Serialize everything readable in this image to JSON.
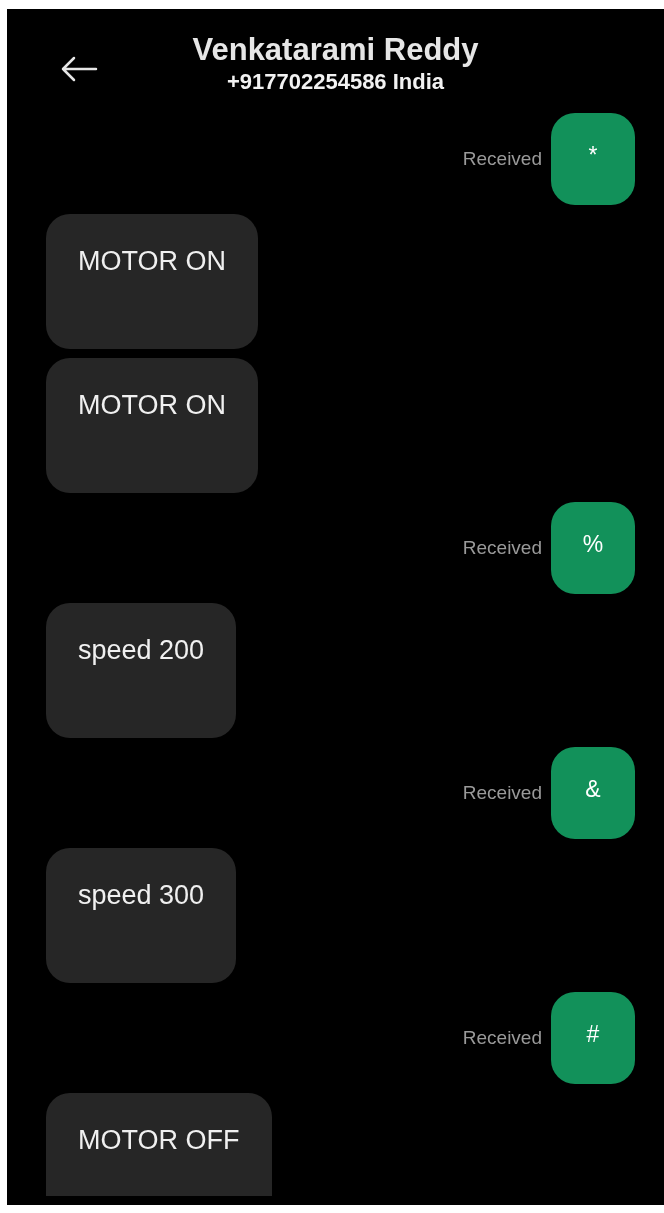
{
  "header": {
    "title": "Venkatarami Reddy",
    "subtitle": "+917702254586 India"
  },
  "messages": [
    {
      "kind": "sent",
      "text": "*",
      "status": "Received"
    },
    {
      "kind": "received",
      "text": "MOTOR ON"
    },
    {
      "kind": "received",
      "text": "MOTOR ON"
    },
    {
      "kind": "sent",
      "text": "%",
      "status": "Received"
    },
    {
      "kind": "received",
      "text": "speed 200"
    },
    {
      "kind": "sent",
      "text": "&",
      "status": "Received"
    },
    {
      "kind": "received",
      "text": "speed 300"
    },
    {
      "kind": "sent",
      "text": "#",
      "status": "Received"
    },
    {
      "kind": "received",
      "text": "MOTOR OFF"
    }
  ]
}
